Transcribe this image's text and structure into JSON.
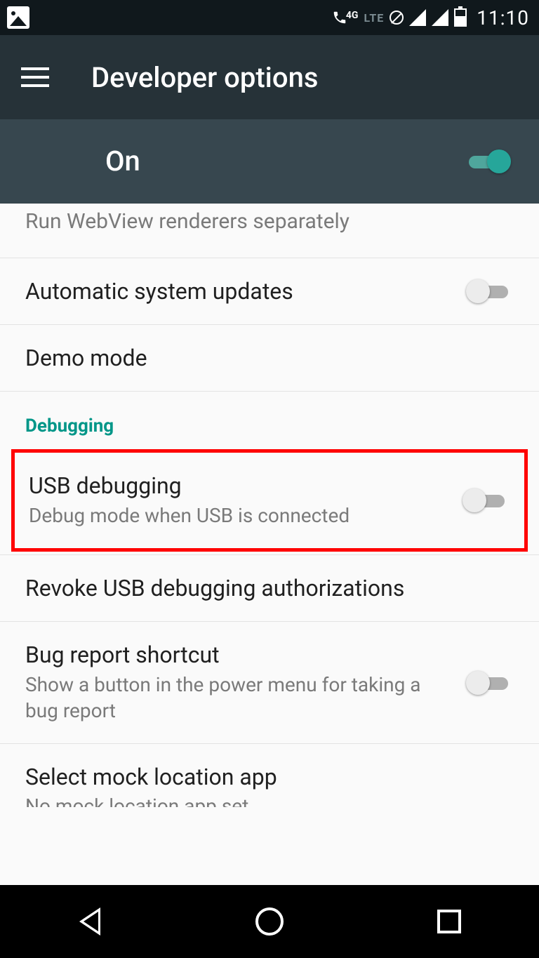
{
  "status": {
    "time": "11:10",
    "network_label": "4G",
    "lte_label": "LTE"
  },
  "header": {
    "title": "Developer options"
  },
  "master": {
    "label": "On",
    "enabled": true
  },
  "section": {
    "debugging_label": "Debugging"
  },
  "settings": {
    "webview_partial": "Run WebView renderers separately",
    "auto_updates": {
      "title": "Automatic system updates",
      "enabled": false
    },
    "demo_mode": {
      "title": "Demo mode"
    },
    "usb_debugging": {
      "title": "USB debugging",
      "sub": "Debug mode when USB is connected",
      "enabled": false
    },
    "revoke": {
      "title": "Revoke USB debugging authorizations"
    },
    "bug_report": {
      "title": "Bug report shortcut",
      "sub": "Show a button in the power menu for taking a bug report",
      "enabled": false
    },
    "mock_location": {
      "title": "Select mock location app",
      "sub": "No mock location app set"
    }
  }
}
